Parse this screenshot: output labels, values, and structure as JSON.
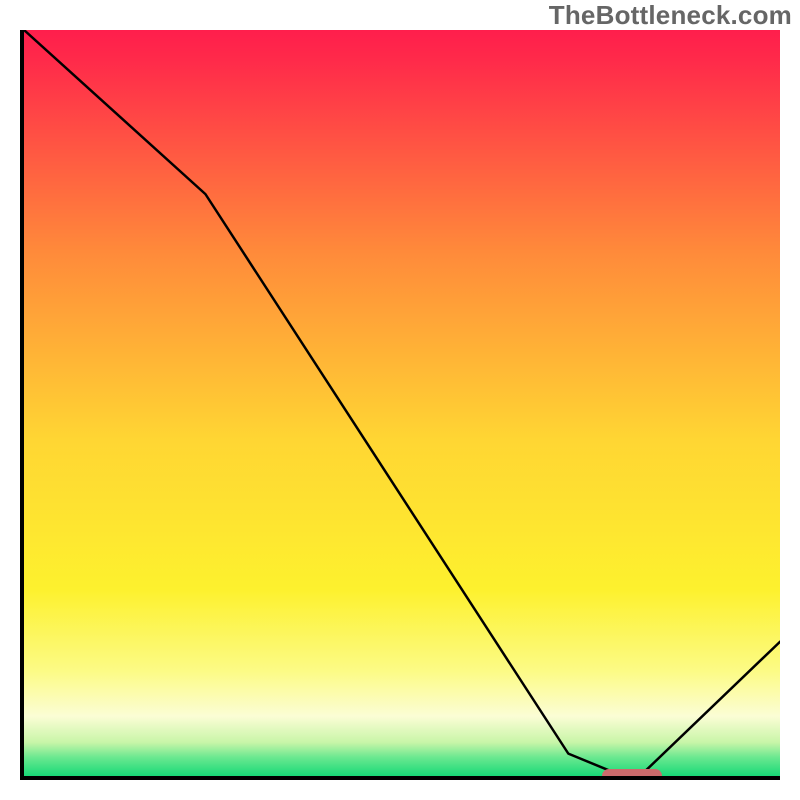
{
  "watermark": "TheBottleneck.com",
  "chart_data": {
    "type": "line",
    "title": "",
    "xlabel": "",
    "ylabel": "",
    "xlim": [
      0,
      100
    ],
    "ylim": [
      0,
      100
    ],
    "series": [
      {
        "name": "bottleneck-curve",
        "x": [
          0,
          24,
          72,
          78,
          82,
          100
        ],
        "y": [
          100,
          78,
          3,
          0.5,
          0.5,
          18
        ]
      }
    ],
    "marker": {
      "x_start": 76,
      "x_end": 84,
      "y": 0.6
    },
    "background_gradient": {
      "stops": [
        {
          "offset": 0.0,
          "color": "#ff1e4c"
        },
        {
          "offset": 0.04,
          "color": "#ff2a4a"
        },
        {
          "offset": 0.3,
          "color": "#ff8b3a"
        },
        {
          "offset": 0.55,
          "color": "#ffd633"
        },
        {
          "offset": 0.75,
          "color": "#fdf12e"
        },
        {
          "offset": 0.86,
          "color": "#fcfb86"
        },
        {
          "offset": 0.92,
          "color": "#fbfdd5"
        },
        {
          "offset": 0.955,
          "color": "#c8f5a8"
        },
        {
          "offset": 0.975,
          "color": "#6be890"
        },
        {
          "offset": 1.0,
          "color": "#18d977"
        }
      ]
    }
  }
}
